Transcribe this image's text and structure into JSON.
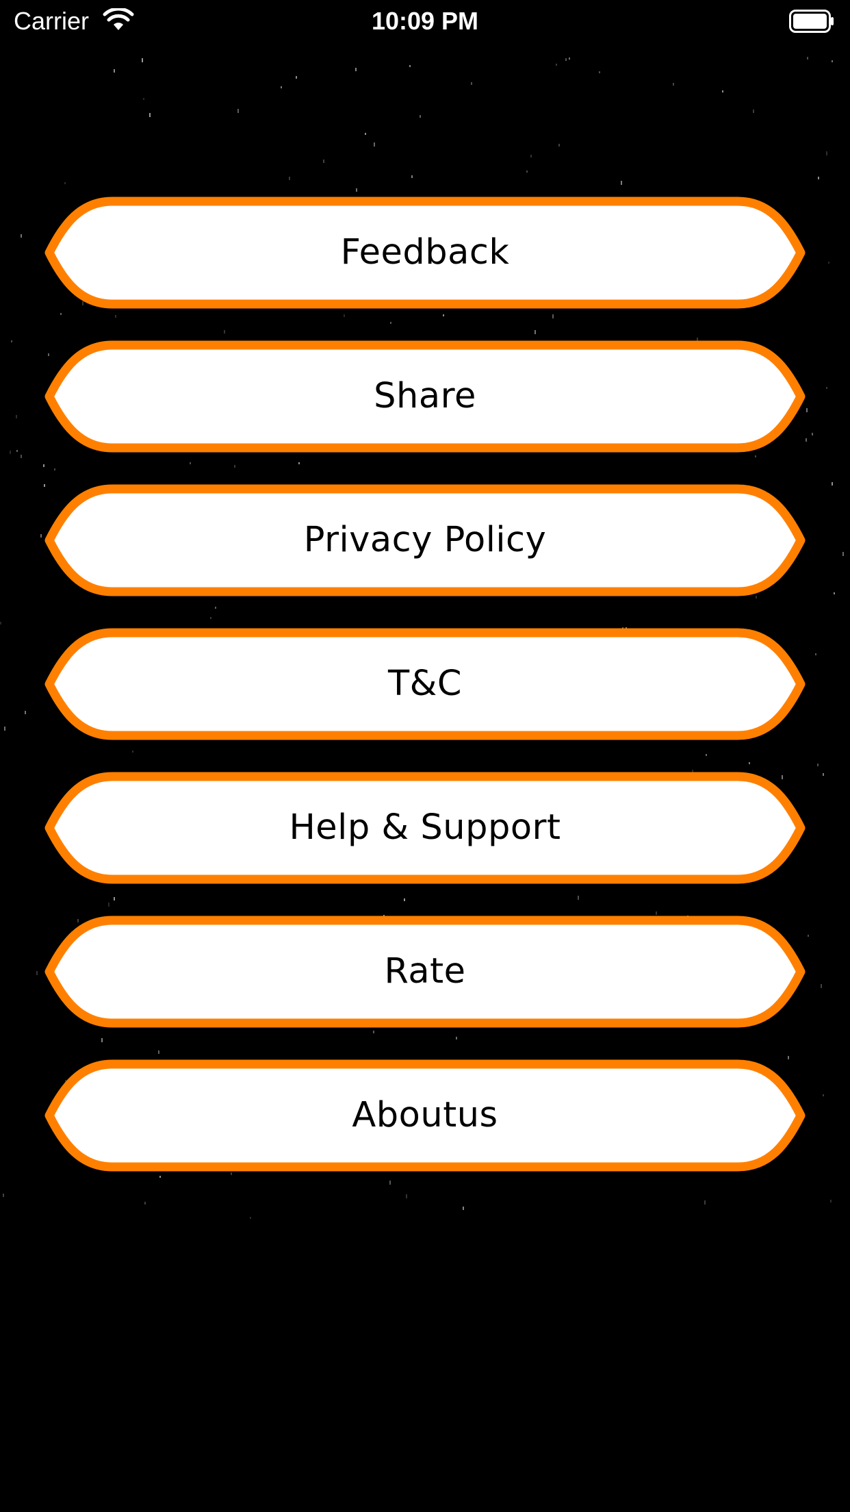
{
  "status_bar": {
    "carrier": "Carrier",
    "time": "10:09 PM",
    "wifi_icon": "wifi-icon",
    "battery_icon": "battery-full-icon"
  },
  "menu": {
    "items": [
      {
        "label": "Feedback"
      },
      {
        "label": "Share"
      },
      {
        "label": "Privacy Policy"
      },
      {
        "label": "T&C"
      },
      {
        "label": "Help & Support"
      },
      {
        "label": "Rate"
      },
      {
        "label": "Aboutus"
      }
    ]
  },
  "colors": {
    "background": "#000000",
    "button_fill": "#ffffff",
    "button_border": "#ff8000",
    "button_text": "#000000",
    "status_text": "#ffffff"
  }
}
